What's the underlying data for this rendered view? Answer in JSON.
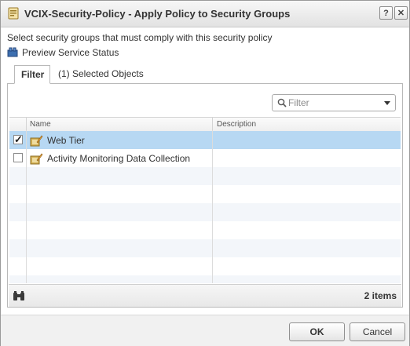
{
  "window": {
    "title": "VCIX-Security-Policy - Apply Policy to Security Groups",
    "help_label": "?",
    "close_label": "✕"
  },
  "instruction": "Select security groups that must comply with this security policy",
  "preview_link": "Preview Service Status",
  "tabs": [
    {
      "label": "Filter",
      "active": true
    },
    {
      "label": "(1) Selected Objects",
      "active": false
    }
  ],
  "filter": {
    "placeholder": "Filter"
  },
  "grid": {
    "columns": [
      "Name",
      "Description"
    ],
    "rows": [
      {
        "name": "Web Tier",
        "description": "",
        "checked": true
      },
      {
        "name": "Activity Monitoring Data Collection",
        "description": "",
        "checked": false
      }
    ],
    "items_count": "2 items"
  },
  "buttons": {
    "ok": "OK",
    "cancel": "Cancel"
  },
  "colors": {
    "selected_row": "#b7d8f3",
    "alt_row": "#f3f6fa"
  },
  "icons": {
    "title": "security-policy-icon",
    "preview": "service-status-icon",
    "row": "security-group-icon",
    "search": "search-icon",
    "footer": "binoculars-icon"
  }
}
